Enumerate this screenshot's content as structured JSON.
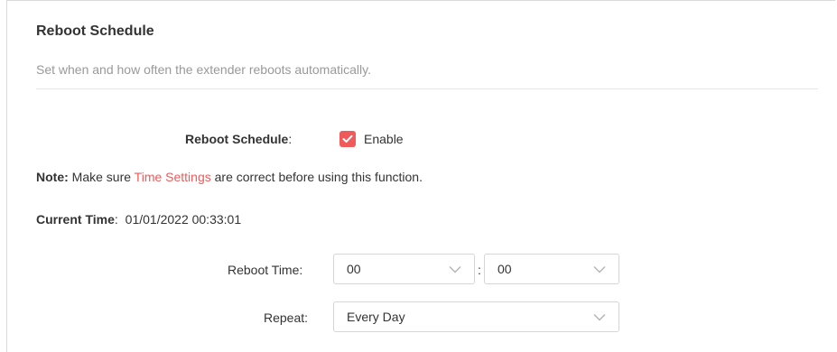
{
  "section": {
    "title": "Reboot Schedule",
    "description": "Set when and how often the extender reboots automatically."
  },
  "schedule": {
    "label": "Reboot Schedule",
    "colon": ":",
    "enable_label": "Enable",
    "enabled": true
  },
  "note": {
    "prefix": "Note:",
    "text_before": " Make sure ",
    "link_text": "Time Settings",
    "text_after": " are correct before using this function."
  },
  "current_time": {
    "label": "Current Time",
    "colon": ":",
    "value": "01/01/2022 00:33:01"
  },
  "reboot_time": {
    "label": "Reboot Time:",
    "hour": "00",
    "separator": ":",
    "minute": "00"
  },
  "repeat": {
    "label": "Repeat:",
    "value": "Every Day"
  },
  "colors": {
    "accent": "#f05a5a",
    "muted_text": "#999999",
    "text": "#333333",
    "border": "#d6d6d6"
  },
  "icons": {
    "checkbox": "checkmark-icon",
    "dropdown": "chevron-down-icon"
  }
}
